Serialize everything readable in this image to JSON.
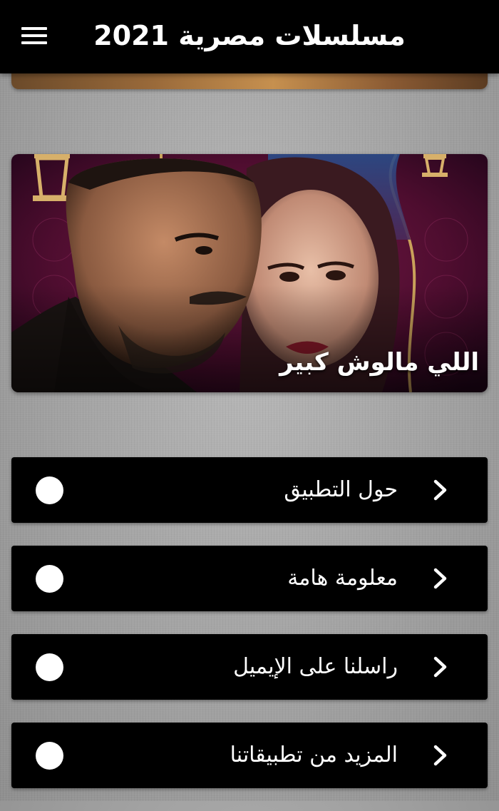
{
  "header": {
    "title": "مسلسلات مصرية 2021",
    "menu_icon": "hamburger-menu-icon"
  },
  "featured": {
    "caption": "اللي مالوش كبير"
  },
  "menu": {
    "items": [
      {
        "label": "حول التطبيق",
        "icon": "chevron-right-icon"
      },
      {
        "label": "معلومة هامة",
        "icon": "chevron-right-icon"
      },
      {
        "label": "راسلنا على الإيميل",
        "icon": "chevron-right-icon"
      },
      {
        "label": "المزيد من تطبيقاتنا",
        "icon": "chevron-right-icon"
      }
    ]
  },
  "colors": {
    "appbar": "#000000",
    "menu_item_bg": "#000000",
    "text": "#ffffff",
    "background": "#a6a6a6"
  }
}
